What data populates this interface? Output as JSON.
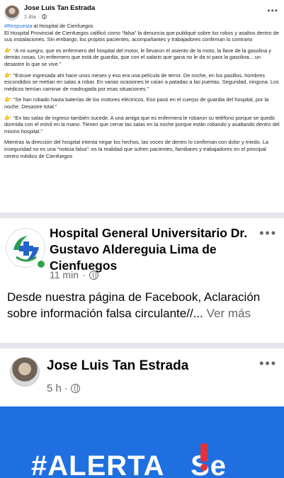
{
  "post1": {
    "author": "Jose Luis Tan Estrada",
    "time": "1 día",
    "hashtag": "#Respuesta",
    "intro_rest": " al Hospital de Cienfuegos",
    "paragraph1": "El Hospital Provincial de Cienfuegos calificó como “falsa” la denuncia que publiqué sobre los robos y asaltos dentro de sus instalaciones. Sin embargo, los propios pacientes, acompañantes y trabajadores confirman lo contrario",
    "quote1": "“A mi suegro, que es enfermero del hospital del motor, le llevaron el asiento de la moto, la llave de la gasolina y demás cosas. Un enfermero que está de guardia, que con el salario que gana no le da ni para la gasolina... un desastre lo que se vive.”",
    "quote2": "“Estuve ingresada ahí hace unos meses y eso era una película de terror. De noche, en los pasillos, hombres escondidos se metían en salas a robar. En varias ocasiones le caían a patadas a las puertas. Seguridad, ninguna. Los médicos temían caminar de madrugada por esas situaciones.”",
    "quote3": "“Se han robado hasta baterías de los motores eléctricos. Eso pasó en el cuerpo de guardia del hospital, por la noche. Desastre total.”",
    "quote4": "“En las salas de ingreso también sucede. A una amiga que es enfermera le robaron su teléfono porque se quedó dormida con el móvil en la mano. Tienen que cerrar las salas en la noche porque están robando y asaltando dentro del mismo hospital.”",
    "closing": "Mientras la dirección del hospital intenta negar los hechos, las voces de dentro lo confirman con dolor y miedo. La inseguridad no es una “noticia falsa”: es la realidad que sufren pacientes, familiares y trabajadores en el principal centro médico de Cienfuegos",
    "more_icon": "ellipsis-icon",
    "hand_icon": "pointing-hand-icon"
  },
  "shared": {
    "page_name": "Hospital General Universitario Dr. Gustavo Aldereguia Lima de Cienfuegos",
    "time": "11 min",
    "text": "Desde nuestra página de Facebook, Aclaración sobre información falsa circulante//...",
    "see_more": "Ver más"
  },
  "post2": {
    "author": "Jose Luis Tan Estrada",
    "time": "5 h",
    "banner_text": "#ALERTA ",
    "banner_text_tail": "Se"
  },
  "colors": {
    "link": "#216fdb",
    "banner": "#1f6fe0",
    "online": "#31a24c"
  }
}
